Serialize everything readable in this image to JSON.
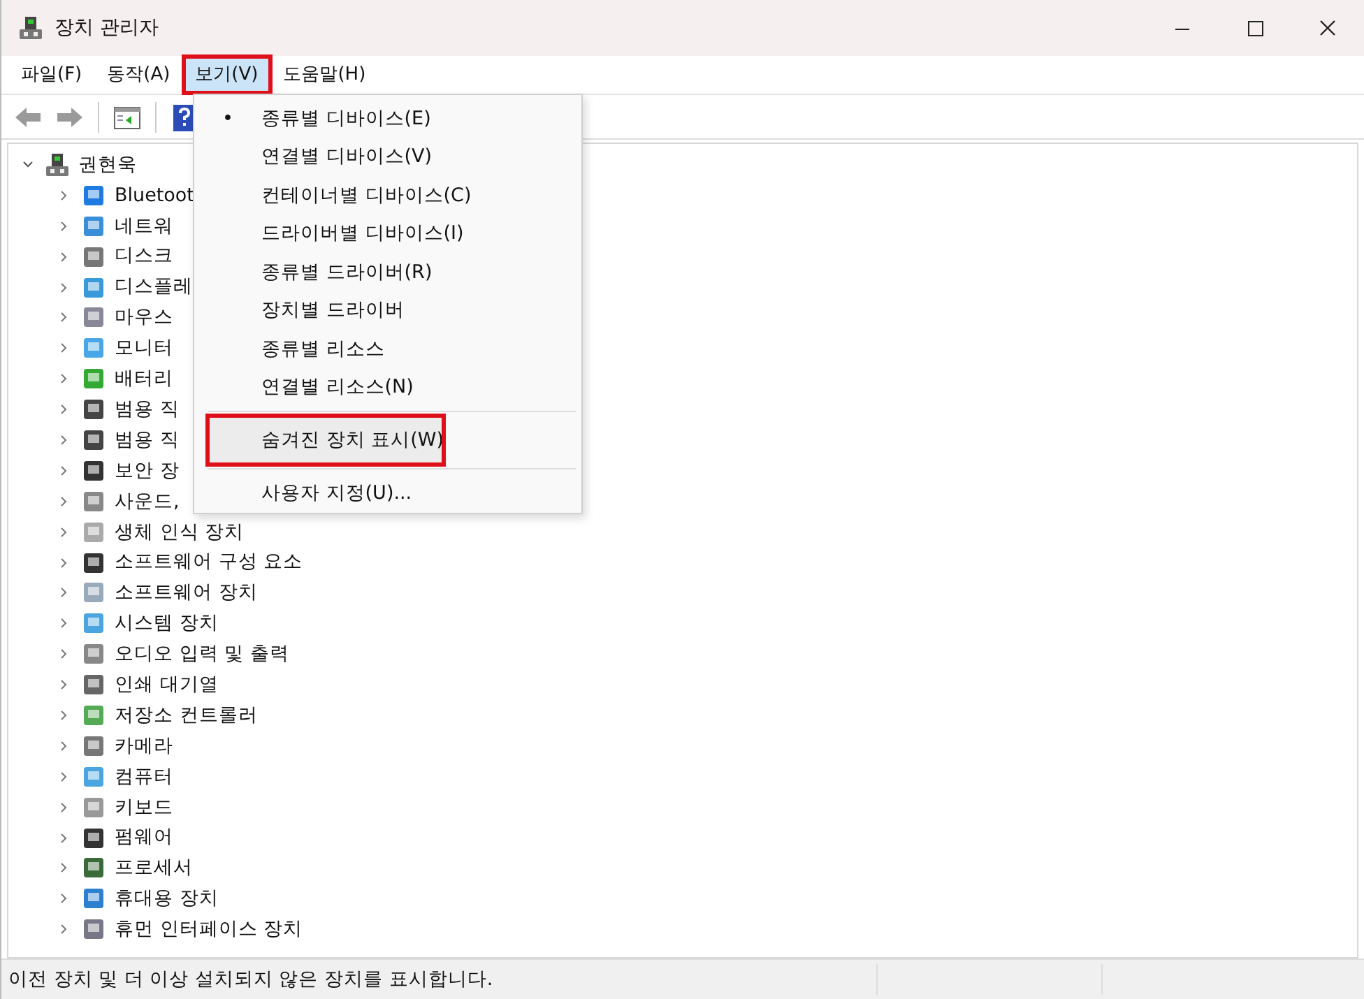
{
  "window": {
    "title": "장치 관리자"
  },
  "menu_bar": [
    {
      "label": "파일(F)",
      "selected": false,
      "annotated": false
    },
    {
      "label": "동작(A)",
      "selected": false,
      "annotated": false
    },
    {
      "label": "보기(V)",
      "selected": true,
      "annotated": true
    },
    {
      "label": "도움말(H)",
      "selected": false,
      "annotated": false
    }
  ],
  "tree": {
    "root": {
      "label": "권현욱",
      "expanded": true,
      "children": [
        {
          "label": "Bluetoot"
        },
        {
          "label": "네트워"
        },
        {
          "label": "디스크"
        },
        {
          "label": "디스플레"
        },
        {
          "label": "마우스"
        },
        {
          "label": "모니터"
        },
        {
          "label": "배터리"
        },
        {
          "label": "범용 직"
        },
        {
          "label": "범용 직"
        },
        {
          "label": "보안 장"
        },
        {
          "label": "사운드,"
        },
        {
          "label": "생체 인식 장치"
        },
        {
          "label": "소프트웨어 구성 요소"
        },
        {
          "label": "소프트웨어 장치"
        },
        {
          "label": "시스템 장치"
        },
        {
          "label": "오디오 입력 및 출력"
        },
        {
          "label": "인쇄 대기열"
        },
        {
          "label": "저장소 컨트롤러"
        },
        {
          "label": "카메라"
        },
        {
          "label": "컴퓨터"
        },
        {
          "label": "키보드"
        },
        {
          "label": "펌웨어"
        },
        {
          "label": "프로세서"
        },
        {
          "label": "휴대용 장치"
        },
        {
          "label": "휴먼 인터페이스 장치"
        }
      ]
    }
  },
  "view_menu": {
    "groups": [
      [
        {
          "label": "종류별 디바이스(E)",
          "checked": true,
          "highlighted": false,
          "annotated": false
        },
        {
          "label": "연결별 디바이스(V)",
          "checked": false,
          "highlighted": false,
          "annotated": false
        },
        {
          "label": "컨테이너별 디바이스(C)",
          "checked": false,
          "highlighted": false,
          "annotated": false
        },
        {
          "label": "드라이버별 디바이스(I)",
          "checked": false,
          "highlighted": false,
          "annotated": false
        },
        {
          "label": "종류별 드라이버(R)",
          "checked": false,
          "highlighted": false,
          "annotated": false
        },
        {
          "label": "장치별 드라이버",
          "checked": false,
          "highlighted": false,
          "annotated": false
        },
        {
          "label": "종류별 리소스",
          "checked": false,
          "highlighted": false,
          "annotated": false
        },
        {
          "label": "연결별 리소스(N)",
          "checked": false,
          "highlighted": false,
          "annotated": false
        }
      ],
      [
        {
          "label": "숨겨진 장치 표시(W)",
          "checked": false,
          "highlighted": true,
          "annotated": true
        }
      ],
      [
        {
          "label": "사용자 지정(U)...",
          "checked": false,
          "highlighted": false,
          "annotated": false
        }
      ]
    ],
    "check_mark": "•"
  },
  "status_bar": {
    "text": "이전 장치 및 더 이상 설치되지 않은 장치를 표시합니다."
  }
}
